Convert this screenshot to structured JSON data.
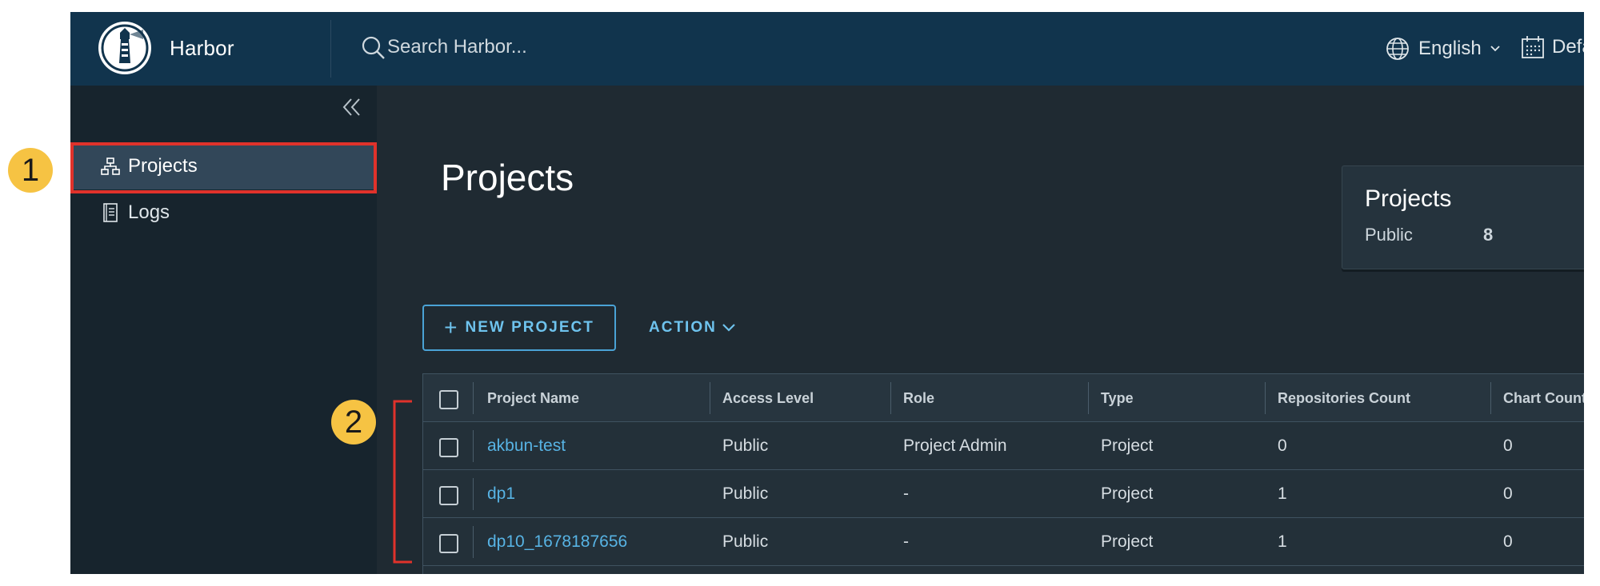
{
  "header": {
    "app_name": "Harbor",
    "search_placeholder": "Search Harbor...",
    "language": "English",
    "datetime_label": "Default",
    "colors": {
      "header_bg": "#11344d",
      "accent": "#57b3e4"
    }
  },
  "sidebar": {
    "items": [
      {
        "label": "Projects",
        "icon": "projects-icon",
        "active": true
      },
      {
        "label": "Logs",
        "icon": "logs-icon",
        "active": false
      }
    ]
  },
  "main": {
    "title": "Projects",
    "summary": {
      "title": "Projects",
      "public_label": "Public",
      "public_count": "8"
    },
    "toolbar": {
      "new_project_label": "NEW PROJECT",
      "action_label": "ACTION"
    },
    "table": {
      "columns": [
        "Project Name",
        "Access Level",
        "Role",
        "Type",
        "Repositories Count",
        "Chart Count"
      ],
      "rows": [
        {
          "name": "akbun-test",
          "access": "Public",
          "role": "Project Admin",
          "type": "Project",
          "repos": "0",
          "charts": "0"
        },
        {
          "name": "dp1",
          "access": "Public",
          "role": "-",
          "type": "Project",
          "repos": "1",
          "charts": "0"
        },
        {
          "name": "dp10_1678187656",
          "access": "Public",
          "role": "-",
          "type": "Project",
          "repos": "1",
          "charts": "0"
        }
      ]
    }
  },
  "annotations": {
    "badge_1": "1",
    "badge_2": "2",
    "highlight_color": "#e0322b",
    "badge_color": "#f6c343"
  }
}
